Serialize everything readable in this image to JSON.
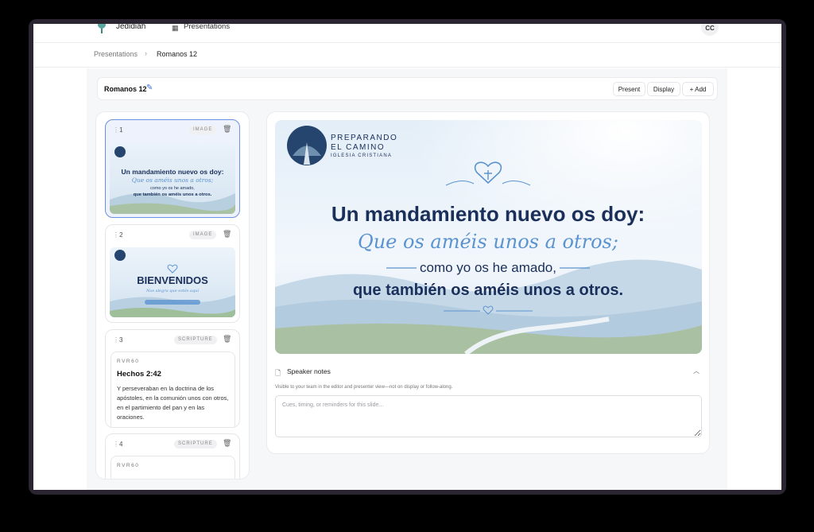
{
  "app": {
    "brand": "Jedidiah",
    "nav_presentations": "Presentations",
    "avatar_initials": "CC"
  },
  "breadcrumb": {
    "root": "Presentations",
    "current": "Romanos 12"
  },
  "toolbar": {
    "title": "Romanos 12",
    "present_label": "Present",
    "display_label": "Display",
    "add_label": "+ Add"
  },
  "slides": [
    {
      "number": "1",
      "type": "IMAGE"
    },
    {
      "number": "2",
      "type": "IMAGE"
    },
    {
      "number": "3",
      "type": "SCRIPTURE",
      "version": "RVR60",
      "reference": "Hechos 2:42",
      "text": "Y perseveraban en la doctrina de los apóstoles, en la comunión unos con otros, en el partimiento del pan y en las oraciones."
    },
    {
      "number": "4",
      "type": "SCRIPTURE",
      "version": "RVR60"
    }
  ],
  "slide_art": {
    "church_line1": "PREPARANDO",
    "church_line2": "EL CAMINO",
    "church_line3": "IGLESIA CRISTIANA",
    "line1": "Un mandamiento nuevo os doy:",
    "line2": "Que os améis unos a otros;",
    "line3": "como yo os he amado,",
    "line4": "que también os améis unos a otros.",
    "welcome": "BIENVENIDOS",
    "welcome_sub": "Nos alegra que estés aquí"
  },
  "notes": {
    "title": "Speaker notes",
    "help": "Visible to your team in the editor and presenter view—not on display or follow-along.",
    "placeholder": "Cues, timing, or reminders for this slide..."
  },
  "colors": {
    "accent": "#3a6fd8",
    "slide_navy": "#1a2f5a",
    "slide_script": "#5b93d0"
  }
}
